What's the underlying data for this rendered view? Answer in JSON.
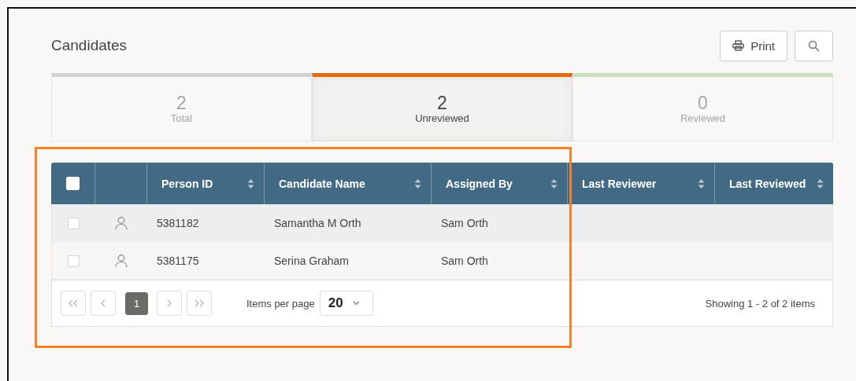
{
  "page": {
    "title": "Candidates"
  },
  "toolbar": {
    "print_label": "Print"
  },
  "tabs": [
    {
      "count": "2",
      "label": "Total",
      "color": "#d0d1d5",
      "selected": false
    },
    {
      "count": "2",
      "label": "Unreviewed",
      "color": "#e3690f",
      "selected": true
    },
    {
      "count": "0",
      "label": "Reviewed",
      "color": "#c9dfb9",
      "selected": false
    }
  ],
  "table": {
    "select_all_checked": false,
    "columns": [
      {
        "label": "Person ID"
      },
      {
        "label": "Candidate Name"
      },
      {
        "label": "Assigned By"
      },
      {
        "label": "Last Reviewer"
      },
      {
        "label": "Last Reviewed"
      }
    ],
    "rows": [
      {
        "checked": false,
        "cells": [
          "5381182",
          "Samantha M Orth",
          "Sam Orth",
          "",
          ""
        ]
      },
      {
        "checked": false,
        "cells": [
          "5381175",
          "Serina Graham",
          "Sam Orth",
          "",
          ""
        ]
      }
    ]
  },
  "pager": {
    "pages": [
      {
        "label": "1",
        "selected": true
      }
    ],
    "items_per_page_label": "Items per page",
    "page_size": "20",
    "summary": "Showing 1 - 2 of 2 items"
  }
}
